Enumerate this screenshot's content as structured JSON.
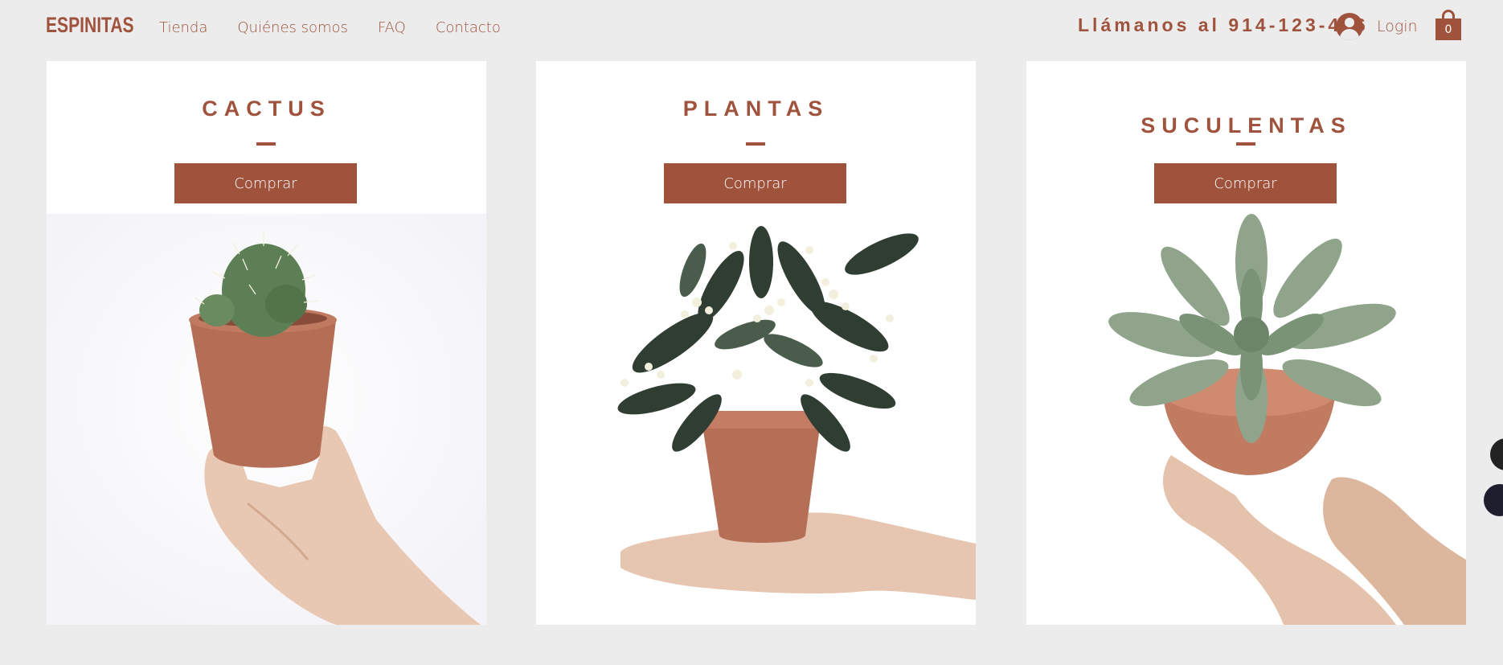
{
  "header": {
    "logo": "ESPINITAS",
    "nav": [
      "Tienda",
      "Quiénes somos",
      "FAQ",
      "Contacto"
    ],
    "phone": "Llámanos al 914-123-456",
    "login_label": "Login",
    "cart_count": "0",
    "login_icon": "user-avatar-icon",
    "cart_icon": "shopping-bag-icon"
  },
  "cards": [
    {
      "title": "CACTUS",
      "button": "Comprar",
      "image": "hand-holding-cactus-pot"
    },
    {
      "title": "PLANTAS",
      "button": "Comprar",
      "image": "hand-holding-flowering-plant-pot"
    },
    {
      "title": "SUCULENTAS",
      "button": "Comprar",
      "image": "hands-holding-succulent-pot"
    }
  ],
  "colors": {
    "accent": "#a0533c",
    "background": "#ececec",
    "card": "#ffffff"
  }
}
